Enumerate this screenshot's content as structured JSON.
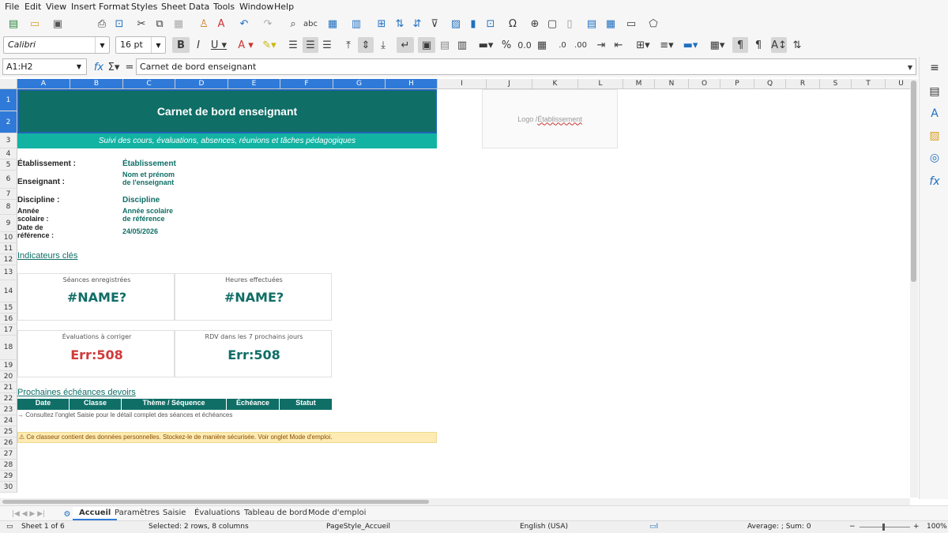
{
  "menu": [
    "File",
    "Edit",
    "View",
    "Insert",
    "Format",
    "Styles",
    "Sheet",
    "Data",
    "Tools",
    "Window",
    "Help"
  ],
  "format_bar": {
    "font_name": "Calibri",
    "font_size": "16 pt"
  },
  "formula_bar": {
    "name_box": "A1:H2",
    "formula": "Carnet de bord enseignant",
    "fx": "fx",
    "sigma": "Σ",
    "equals": "="
  },
  "columns": [
    "A",
    "B",
    "C",
    "D",
    "E",
    "F",
    "G",
    "H",
    "I",
    "J",
    "K",
    "L",
    "M",
    "N",
    "O",
    "P",
    "Q",
    "R",
    "S",
    "T",
    "U"
  ],
  "rows": [
    "1",
    "2",
    "3",
    "4",
    "5",
    "6",
    "7",
    "8",
    "9",
    "10",
    "11",
    "12",
    "13",
    "14",
    "15",
    "16",
    "17",
    "18",
    "19",
    "20",
    "21",
    "22",
    "23",
    "24",
    "25",
    "26",
    "27",
    "28",
    "29",
    "30"
  ],
  "sheet": {
    "title": "Carnet de bord enseignant",
    "subtitle": "Suivi des cours, évaluations, absences, réunions et tâches pédagogiques",
    "logo_prefix": "Logo / ",
    "logo_word": "Établissement",
    "fields": [
      {
        "label": "Établissement :",
        "value": "Établissement"
      },
      {
        "label": "Enseignant :",
        "value": "Nom et prénom de l'enseignant"
      },
      {
        "label": "Discipline :",
        "value": "Discipline"
      },
      {
        "label": "Année scolaire :",
        "value": "Année scolaire de référence"
      },
      {
        "label": "Date de référence :",
        "value": "24/05/2026"
      }
    ],
    "kpi_heading": "Indicateurs clés",
    "kpis": [
      {
        "label": "Séances enregistrées",
        "value": "#NAME?"
      },
      {
        "label": "Heures effectuées",
        "value": "#NAME?"
      },
      {
        "label": "Évaluations à corriger",
        "value": "Err:508"
      },
      {
        "label": "RDV dans les 7 prochains jours",
        "value": "Err:508"
      }
    ],
    "deadlines_heading": "Prochaines échéances devoirs",
    "deadline_columns": [
      "Date",
      "Classe",
      "Thème / Séquence",
      "Échéance",
      "Statut"
    ],
    "hint": "→ Consultez l'onglet Saisie pour le détail complet des séances et échéances",
    "warning": "⚠ Ce classeur contient des données personnelles. Stockez-le de manière sécurisée. Voir onglet Mode d'emploi."
  },
  "tabs": [
    "Accueil",
    "Paramètres",
    "Saisie",
    "Évaluations",
    "Tableau de bord",
    "Mode d'emploi"
  ],
  "status": {
    "sheet": "Sheet 1 of 6",
    "selection": "Selected: 2 rows, 8 columns",
    "page_style": "PageStyle_Accueil",
    "language": "English (USA)",
    "sum": "Average: ; Sum: 0",
    "zoom": "100%"
  },
  "colors": {
    "title_bg": "#0f6e66",
    "subtitle_bg": "#13b3a4",
    "accent_text": "#0f6e66",
    "error_red": "#d03a3a",
    "warning_bg": "#fdebb3"
  }
}
